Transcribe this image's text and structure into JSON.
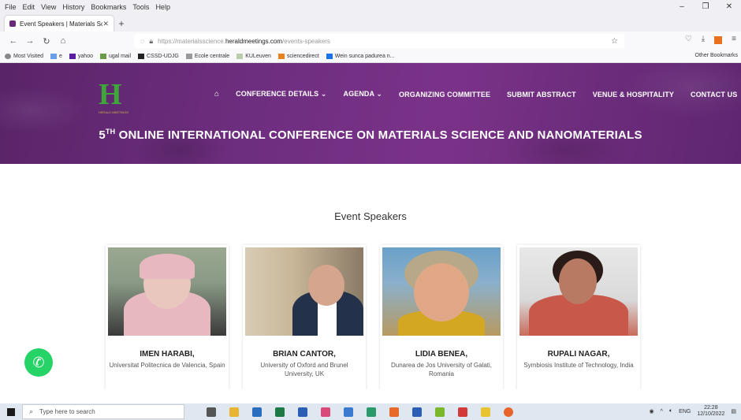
{
  "browser": {
    "menu": [
      "File",
      "Edit",
      "View",
      "History",
      "Bookmarks",
      "Tools",
      "Help"
    ],
    "window_controls": [
      "–",
      "❐",
      "✕"
    ],
    "tab_title": "Event Speakers | Materials Scien",
    "url_prefix": "https://materialsscience.",
    "url_host": "heraldmeetings.com",
    "url_path": "/events-speakers",
    "bookmarks": [
      "Most Visited",
      "e",
      "yahoo",
      "ugal mail",
      "CSSD-UDJG",
      "Ecole centrale",
      "KULeuven",
      "sciencedirect",
      "Wein sunca padurea n..."
    ],
    "other_bookmarks": "Other Bookmarks"
  },
  "site": {
    "logo_caption": "HERALD MEETINGS",
    "nav": [
      "CONFERENCE DETAILS ⌄",
      "AGENDA ⌄",
      "ORGANIZING COMMITTEE",
      "SUBMIT ABSTRACT",
      "VENUE & HOSPITALITY",
      "CONTACT US"
    ],
    "title_num": "5",
    "title_sup": "TH",
    "title_rest": " ONLINE INTERNATIONAL CONFERENCE ON MATERIALS SCIENCE AND NANOMATERIALS",
    "section_title": "Event Speakers",
    "speakers": [
      {
        "name": "IMEN HARABI,",
        "affil": "Universitat Politecnica de Valencia, Spain"
      },
      {
        "name": "BRIAN CANTOR,",
        "affil": "University of Oxford and Brunel University, UK"
      },
      {
        "name": "LIDIA BENEA,",
        "affil": "Dunarea de Jos University of Galati, Romania"
      },
      {
        "name": "RUPALI NAGAR,",
        "affil": "Symbiosis Institute of Technology, India"
      }
    ]
  },
  "taskbar": {
    "search_placeholder": "Type here to search",
    "lang": "ENG",
    "time": "22:28",
    "date": "12/10/2022"
  }
}
